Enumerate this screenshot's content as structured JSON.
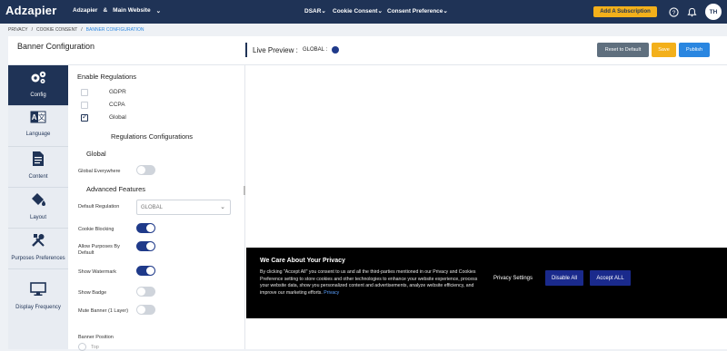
{
  "topbar": {
    "logo": "Adzapier",
    "workspace_1": "Adzapier",
    "workspace_sep": "&",
    "workspace_2": "Main Website",
    "nav": [
      "DSAR",
      "Cookie Consent",
      "Consent Preference"
    ],
    "subscription_label": "Add A Subscription",
    "avatar_initials": "TH"
  },
  "breadcrumb": [
    "PRIVACY",
    "/",
    "COOKIE CONSENT",
    "/",
    "BANNER CONFIGURATION"
  ],
  "header": {
    "title": "Banner Configuration",
    "preview_label": "Live Preview :",
    "preview_regulation": "GLOBAL :",
    "buttons": {
      "reset": "Reset to Default",
      "save": "Save",
      "publish": "Publish"
    },
    "colors": {
      "reset": "#5f6f7e",
      "save": "#f3b01b",
      "publish": "#2a86e0"
    }
  },
  "sidenav": [
    {
      "label": "Config",
      "icon": "gears-icon",
      "active": true
    },
    {
      "label": "Language",
      "icon": "translate-icon",
      "active": false
    },
    {
      "label": "Content",
      "icon": "document-icon",
      "active": false
    },
    {
      "label": "Layout",
      "icon": "paint-bucket-icon",
      "active": false
    },
    {
      "label": "Purposes Preferences",
      "icon": "tools-icon",
      "active": false
    },
    {
      "label": "Display Frequency",
      "icon": "monitor-icon",
      "active": false
    }
  ],
  "config": {
    "enable_regulations_title": "Enable Regulations",
    "regulations": [
      {
        "label": "GDPR",
        "checked": false
      },
      {
        "label": "CCPA",
        "checked": false
      },
      {
        "label": "Global",
        "checked": true
      }
    ],
    "regulations_config_title": "Regulations Configurations",
    "global_title": "Global",
    "global_everywhere_label": "Global Everywhere",
    "advanced_title": "Advanced Features",
    "default_regulation_label": "Default Regulation",
    "default_regulation_value": "GLOBAL",
    "toggles": [
      {
        "label": "Cookie Blocking",
        "on": true
      },
      {
        "label": "Allow Purposes By Default",
        "on": true
      },
      {
        "label": "Show Watermark",
        "on": true
      },
      {
        "label": "Show Badge",
        "on": false
      },
      {
        "label": "Mute Banner (1 Layer)",
        "on": false
      }
    ],
    "banner_position_label": "Banner Position",
    "banner_position_option": "Top"
  },
  "banner": {
    "title": "We Care About Your Privacy",
    "text": "By clicking \"Accept All\" you consent to us and all the third-parties mentioned in our Privacy and Cookies Preference setting to store cookies and other technologies to enhance your website experience, process your website data, show you personalized content and advertisements, analyze website efficiency, and improve our marketing efforts.",
    "link": "Privacy",
    "settings_label": "Privacy Settings",
    "disable_label": "Disable All",
    "accept_label": "Accept ALL"
  }
}
